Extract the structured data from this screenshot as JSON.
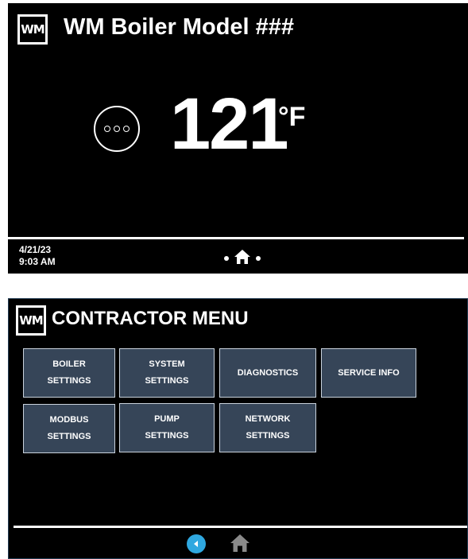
{
  "home_screen": {
    "logo_text": "WM",
    "title": "WM Boiler Model ###",
    "temperature": "121",
    "unit": "°F",
    "date": "4/21/23",
    "time": "9:03 AM",
    "icons": {
      "more": "more-options-icon",
      "home": "home-icon"
    }
  },
  "contractor_menu": {
    "logo_text": "WM",
    "title": "CONTRACTOR MENU",
    "buttons": [
      {
        "label": "BOILER\nSETTINGS"
      },
      {
        "label": "SYSTEM\nSETTINGS"
      },
      {
        "label": "DIAGNOSTICS"
      },
      {
        "label": "SERVICE INFO"
      },
      {
        "label": "MODBUS\nSETTINGS"
      },
      {
        "label": "PUMP\nSETTINGS"
      },
      {
        "label": "NETWORK\nSETTINGS"
      }
    ],
    "icons": {
      "back": "back-arrow-icon",
      "home": "home-icon"
    }
  },
  "colors": {
    "panel_bg": "#000000",
    "button_bg": "#364558",
    "button_border": "#c9d2dc",
    "back_blue": "#2fa8e0",
    "home_gray": "#8a8a8a"
  }
}
